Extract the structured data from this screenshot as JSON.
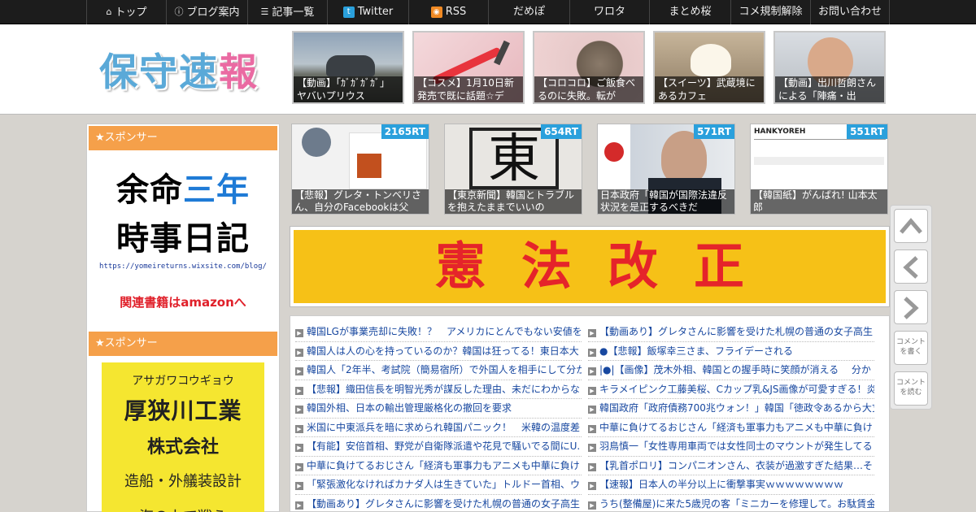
{
  "nav": {
    "items": [
      {
        "label": "トップ",
        "icon": "home-icon"
      },
      {
        "label": "ブログ案内",
        "icon": "info-icon"
      },
      {
        "label": "記事一覧",
        "icon": "list-icon"
      },
      {
        "label": "Twitter",
        "icon": "twitter-icon"
      },
      {
        "label": "RSS",
        "icon": "rss-icon"
      },
      {
        "label": "だめぽ"
      },
      {
        "label": "ワロタ"
      },
      {
        "label": "まとめ桜"
      },
      {
        "label": "コメ規制解除"
      },
      {
        "label": "お問い合わせ"
      }
    ]
  },
  "header": {
    "logo_a": "保守速",
    "logo_b": "報",
    "thumbs": [
      {
        "caption": "【動画】「ｶﾞｶﾞｶﾞｶﾞ」ヤバいプリウス"
      },
      {
        "caption": "【コスメ】1月10日新発売で既に話題☆デ"
      },
      {
        "caption": "【コロコロ】ご飯食べるのに失敗。転が"
      },
      {
        "caption": "【スイーツ】武蔵境にあるカフェ"
      },
      {
        "caption": "【動画】出川哲朗さんによる「陣痛・出"
      }
    ]
  },
  "sidebar": {
    "sponsor1": "★スポンサー",
    "sponsor2": "★スポンサー",
    "ad1": {
      "line1a": "余命",
      "line1b": "三年",
      "line2": "時事日記",
      "url": "https://yomeireturns.wixsite.com/blog/",
      "amazon": "関連書籍はamazonへ"
    },
    "ad2": {
      "kana": "アサガワコウギョウ",
      "name1": "厚狭川工業",
      "name2": "株式会社",
      "desc": "造船・外艤装設計",
      "extra": "海の上で戦う"
    }
  },
  "rt_posts": [
    {
      "count": "2165RT",
      "caption": "【悲報】グレタ・トンベリさん、自分のFacebookは父"
    },
    {
      "count": "654RT",
      "caption": "【東京新聞】韓国とトラブルを抱えたままでいいの"
    },
    {
      "count": "571RT",
      "caption": "日本政府「韓国が国際法違反状況を是正するべきだ"
    },
    {
      "count": "551RT",
      "caption": "【韓国紙】がんばれ! 山本太郎"
    }
  ],
  "banner": {
    "text": "憲法改正"
  },
  "news": {
    "left": [
      "韓国LGが事業売却に失敗！？　アメリカにとんでもない安値を",
      "韓国人は人の心を持っているのか？韓国は狂ってる！東日本大",
      "韓国人「2年半、考試院（簡易宿所）で外国人を相手にして分か",
      "【悲報】織田信長を明智光秀が謀反した理由、未だにわからな",
      "韓国外相、日本の輸出管理厳格化の撤回を要求",
      "米国に中東派兵を暗に求められ韓国パニック！　米韓の温度差",
      "【有能】安倍首相、野党が自衛隊派遣や花見で騒いでる間にU.",
      "中華に負けてるおじさん「経済も軍事力もアニメも中華に負け",
      "「緊張激化なければカナダ人は生きていた」トルドー首相、ウ",
      "【動画あり】グレタさんに影響を受けた札幌の普通の女子高生"
    ],
    "right": [
      "【動画あり】グレタさんに影響を受けた札幌の普通の女子高生",
      "●【悲報】飯塚幸三さま、フライデーされる",
      "|●|【画像】茂木外相、韓国との握手時に笑顔が消える　 分か",
      "キラメイピンク工藤美桜、Cカップ乳&JS画像が可愛すぎる！炎",
      "韓国政府「政府債務700兆ウォン！」韓国「徳政令あるから大丈",
      "中華に負けてるおじさん「経済も軍事力もアニメも中華に負け",
      "羽鳥慎一「女性専用車両では女性同士のマウントが発生してる",
      "【乳首ポロリ】コンパニオンさん、衣装が過激すぎた結果…そ",
      "【速報】日本人の半分以上に衝撃事実ｗｗｗｗｗｗｗｗ",
      "うち(整備屋)に来た5歳児の客「ミニカーを修理して。お駄賃金"
    ]
  },
  "right_nav": {
    "comment_write": "コメントを書く",
    "comment_read": "コメントを読む"
  },
  "colors": {
    "sponsor_bar": "#f5a04a",
    "rt_badge": "#2aa0dc",
    "banner_bg": "#f6c117",
    "banner_text": "#e5242a",
    "link": "#1848a0"
  }
}
